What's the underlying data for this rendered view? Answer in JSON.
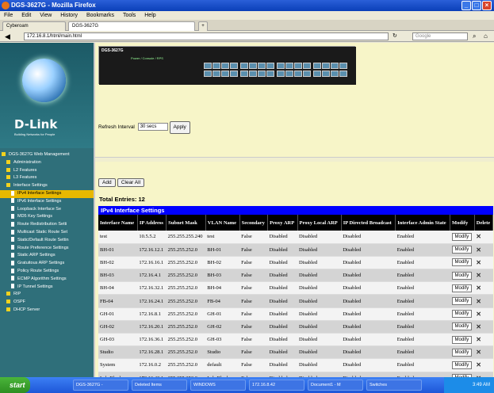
{
  "window": {
    "title": "DGS-3627G - Mozilla Firefox",
    "min": "_",
    "max": "□",
    "close": "×"
  },
  "menu": [
    "File",
    "Edit",
    "View",
    "History",
    "Bookmarks",
    "Tools",
    "Help"
  ],
  "tabs": [
    "Cyberoam",
    "DGS-3627G"
  ],
  "tab_new": "+",
  "address": "172.16.8.1/html/main.html",
  "search_placeholder": "Google",
  "logo": {
    "brand": "D-Link",
    "tagline": "Building Networks for People"
  },
  "tree": [
    {
      "label": "DGS-3627G Web Management",
      "kind": "sq"
    },
    {
      "label": "Administration",
      "kind": "sq"
    },
    {
      "label": "L2 Features",
      "kind": "sq"
    },
    {
      "label": "L3 Features",
      "kind": "sq"
    },
    {
      "label": "Interface Settings",
      "kind": "sq"
    },
    {
      "label": "IPv4 Interface Settings",
      "kind": "doc",
      "selected": true
    },
    {
      "label": "IPv6 Interface Settings",
      "kind": "doc"
    },
    {
      "label": "Loopback Interface Se",
      "kind": "doc"
    },
    {
      "label": "MD5 Key Settings",
      "kind": "doc"
    },
    {
      "label": "Route Redistribution Setti",
      "kind": "doc"
    },
    {
      "label": "Multicast Static Route Set",
      "kind": "doc"
    },
    {
      "label": "Static/Default Route Settin",
      "kind": "doc"
    },
    {
      "label": "Route Preference Settings",
      "kind": "doc"
    },
    {
      "label": "Static ARP Settings",
      "kind": "doc"
    },
    {
      "label": "Gratuitous ARP Settings",
      "kind": "doc"
    },
    {
      "label": "Policy Route Settings",
      "kind": "doc"
    },
    {
      "label": "ECMP Algorithm Settings",
      "kind": "doc"
    },
    {
      "label": "IP Tunnel Settings",
      "kind": "doc"
    },
    {
      "label": "RIP",
      "kind": "sq"
    },
    {
      "label": "OSPF",
      "kind": "sq"
    },
    {
      "label": "DHCP Server",
      "kind": "sq"
    }
  ],
  "device": {
    "model": "DGS-3627G",
    "legend": "Power / Console / RPS"
  },
  "refresh": {
    "label": "Refresh Interval",
    "value": "30 secs",
    "button": "Apply"
  },
  "actions": {
    "add": "Add",
    "clear": "Clear All"
  },
  "total_entries": "Total Entries: 12",
  "table_title": "IPv4 Interface Settings",
  "columns": [
    "Interface Name",
    "IP Address",
    "Subnet Mask",
    "VLAN Name",
    "Secondary",
    "Proxy ARP",
    "Proxy Local ARP",
    "IP Directed Broadcast",
    "Interface Admin State",
    "Modify",
    "Delete"
  ],
  "rows": [
    [
      "test",
      "10.5.5.2",
      "255.255.255.240",
      "test",
      "False",
      "Disabled",
      "Disabled",
      "Disabled",
      "Enabled"
    ],
    [
      "BH-01",
      "172.16.12.1",
      "255.255.252.0",
      "BH-01",
      "False",
      "Disabled",
      "Disabled",
      "Disabled",
      "Enabled"
    ],
    [
      "BH-02",
      "172.16.16.1",
      "255.255.252.0",
      "BH-02",
      "False",
      "Disabled",
      "Disabled",
      "Disabled",
      "Enabled"
    ],
    [
      "BH-03",
      "172.16.4.1",
      "255.255.252.0",
      "BH-03",
      "False",
      "Disabled",
      "Disabled",
      "Disabled",
      "Enabled"
    ],
    [
      "BH-04",
      "172.16.32.1",
      "255.255.252.0",
      "BH-04",
      "False",
      "Disabled",
      "Disabled",
      "Disabled",
      "Enabled"
    ],
    [
      "FB-04",
      "172.16.24.1",
      "255.255.252.0",
      "FB-04",
      "False",
      "Disabled",
      "Disabled",
      "Disabled",
      "Enabled"
    ],
    [
      "GH-01",
      "172.16.8.1",
      "255.255.252.0",
      "GH-01",
      "False",
      "Disabled",
      "Disabled",
      "Disabled",
      "Enabled"
    ],
    [
      "GH-02",
      "172.16.20.1",
      "255.255.252.0",
      "GH-02",
      "False",
      "Disabled",
      "Disabled",
      "Disabled",
      "Enabled"
    ],
    [
      "GH-03",
      "172.16.36.1",
      "255.255.252.0",
      "GH-03",
      "False",
      "Disabled",
      "Disabled",
      "Disabled",
      "Enabled"
    ],
    [
      "Studio",
      "172.16.28.1",
      "255.255.252.0",
      "Studio",
      "False",
      "Disabled",
      "Disabled",
      "Disabled",
      "Enabled"
    ],
    [
      "System",
      "172.16.0.2",
      "255.255.252.0",
      "default",
      "False",
      "Disabled",
      "Disabled",
      "Disabled",
      "Enabled"
    ],
    [
      "Lab-Block",
      "172.16.40.1",
      "255.255.252.0",
      "Lab-Block",
      "False",
      "Disabled",
      "Disabled",
      "Disabled",
      "Enabled"
    ]
  ],
  "modify_label": "Modify",
  "delete_label": "✕",
  "taskbar": {
    "start": "start",
    "tasks": [
      "DGS-3627G -",
      "Deleted Items",
      "WINDOWS",
      "172.16.8.42",
      "Document1 - M",
      "Switches"
    ],
    "clock": "3:49 AM"
  }
}
